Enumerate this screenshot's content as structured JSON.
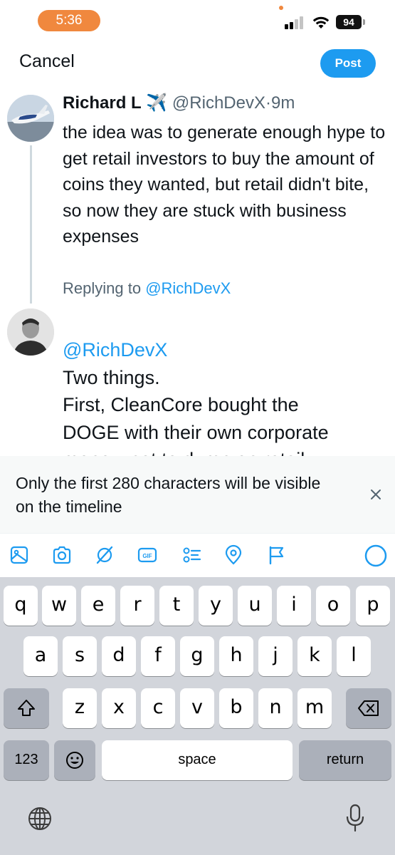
{
  "status_bar": {
    "time": "5:36",
    "battery": "94",
    "accent_color": "#f0883e"
  },
  "header": {
    "cancel_label": "Cancel",
    "post_label": "Post",
    "post_color": "#1d9bf0"
  },
  "original_tweet": {
    "author_name": "Richard L",
    "author_emoji": "✈️",
    "handle": "@RichDevX",
    "separator": "·",
    "age": "9m",
    "text": "the idea was to generate enough hype to get retail investors to buy the amount of coins they wanted, but retail didn't bite, so now they are stuck with business expenses"
  },
  "reply": {
    "replying_prefix": "Replying to",
    "replying_handle": "@RichDevX",
    "mention": "@RichDevX",
    "lines": [
      "Two things.",
      "First, CleanCore bought the",
      "DOGE with their own corporate",
      "money, not to dump on retail"
    ]
  },
  "notice": {
    "text": "Only the first 280 characters will be visible on the timeline",
    "close_icon": "close-icon"
  },
  "toolbar": {
    "icons": [
      "image-icon",
      "camera-icon",
      "grok-icon",
      "gif-icon",
      "poll-icon",
      "location-icon",
      "flag-icon",
      "character-progress-icon"
    ],
    "gif_label": "GIF"
  },
  "keyboard": {
    "row1": [
      "q",
      "w",
      "e",
      "r",
      "t",
      "y",
      "u",
      "i",
      "o",
      "p"
    ],
    "row2": [
      "a",
      "s",
      "d",
      "f",
      "g",
      "h",
      "j",
      "k",
      "l"
    ],
    "row3": [
      "z",
      "x",
      "c",
      "v",
      "b",
      "n",
      "m"
    ],
    "numbers_label": "123",
    "space_label": "space",
    "return_label": "return"
  }
}
